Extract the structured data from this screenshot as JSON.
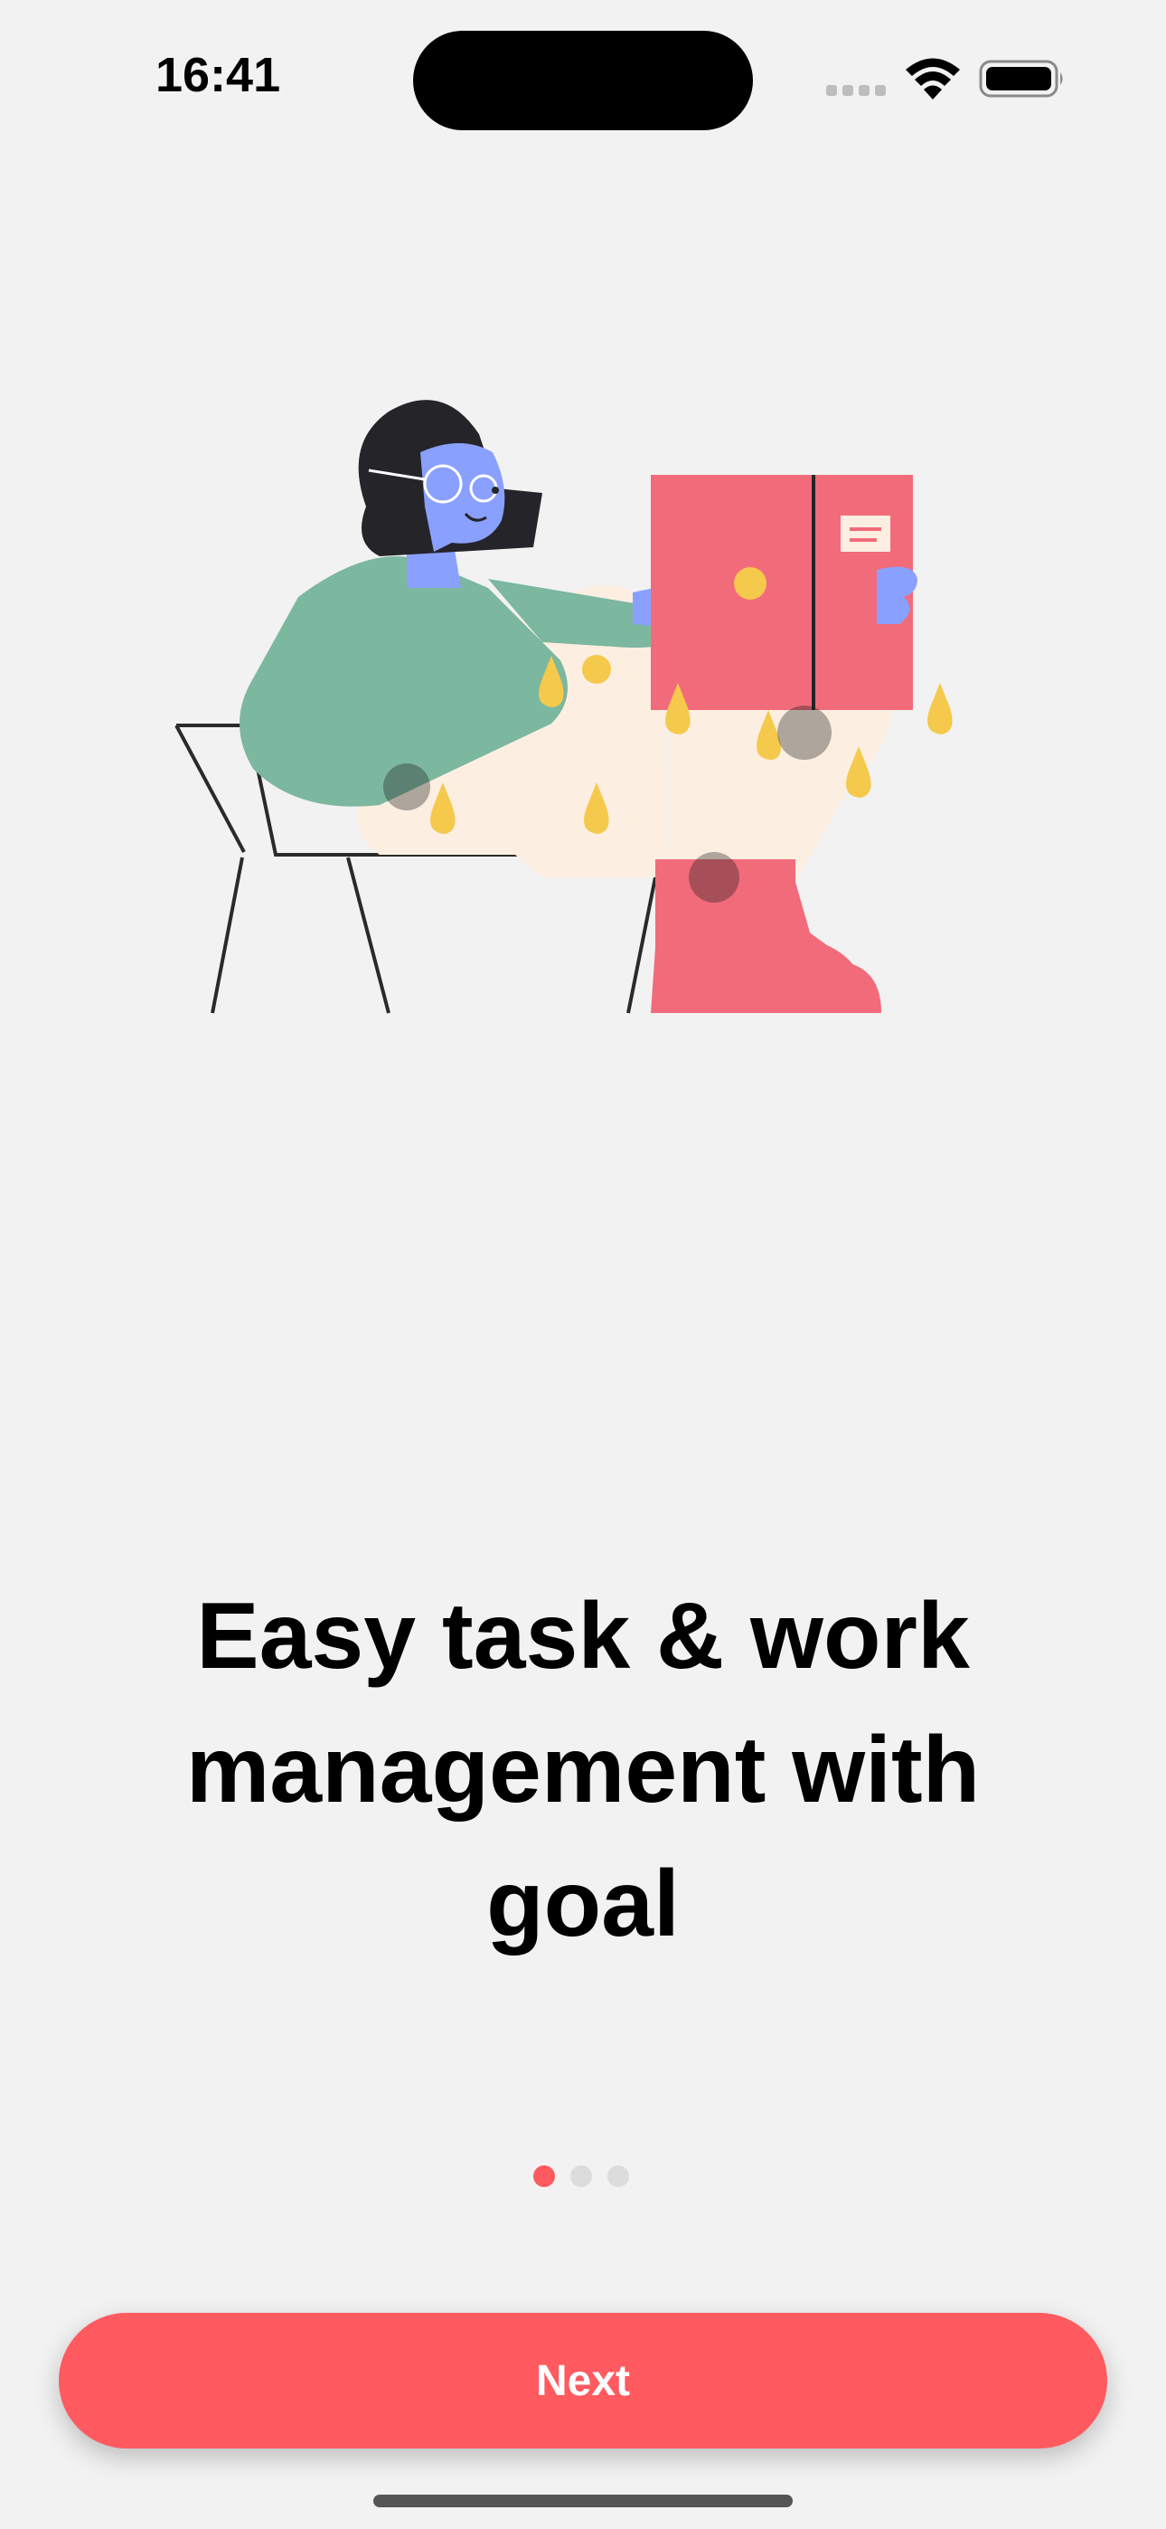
{
  "status_bar": {
    "time": "16:41"
  },
  "onboarding": {
    "title": "Easy task & work management with goal",
    "page_count": 3,
    "current_page": 1
  },
  "actions": {
    "next_label": "Next"
  },
  "colors": {
    "accent": "#fe5a5f",
    "background": "#f2f2f2",
    "dot_inactive": "#dcdcdc"
  },
  "icons": [
    "signal-icon",
    "wifi-icon",
    "battery-icon"
  ]
}
